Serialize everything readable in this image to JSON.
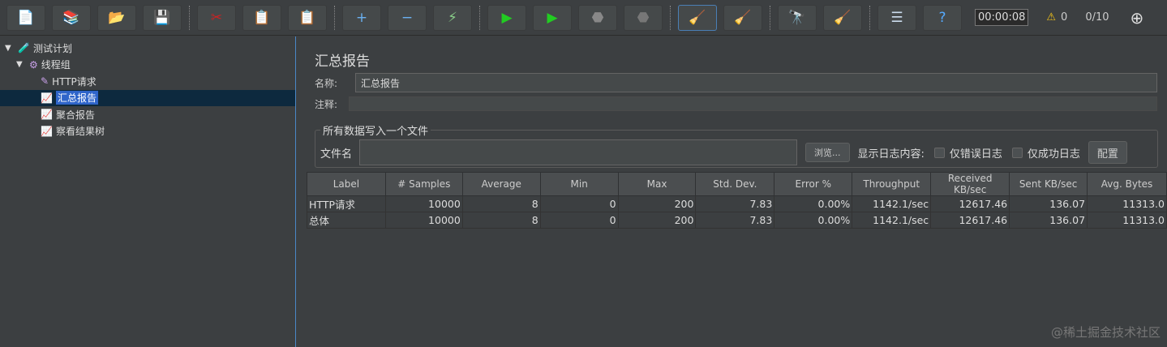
{
  "toolbar": {
    "buttons": [
      [
        "new-icon",
        "📄"
      ],
      [
        "templates-icon",
        "📚"
      ],
      [
        "open-icon",
        "📂"
      ],
      [
        "save-icon",
        "💾"
      ],
      [
        "sep"
      ],
      [
        "cut-icon",
        "✂"
      ],
      [
        "copy-icon",
        "📋"
      ],
      [
        "paste-icon",
        "📋"
      ],
      [
        "sep"
      ],
      [
        "expand-icon",
        "+"
      ],
      [
        "collapse-icon",
        "−"
      ],
      [
        "toggle-icon",
        "⚡"
      ],
      [
        "sep"
      ],
      [
        "start-icon",
        "▶"
      ],
      [
        "start-no-timers-icon",
        "▶"
      ],
      [
        "stop-icon",
        "⬣"
      ],
      [
        "shutdown-icon",
        "⬣"
      ],
      [
        "sep"
      ],
      [
        "clear-icon",
        "🧹"
      ],
      [
        "clear-all-icon",
        "🧹"
      ],
      [
        "sep"
      ],
      [
        "search-icon",
        "🔭"
      ],
      [
        "reset-search-icon",
        "🧹"
      ],
      [
        "sep"
      ],
      [
        "function-helper-icon",
        "☰"
      ],
      [
        "help-icon",
        "?"
      ]
    ],
    "timer": "00:00:08",
    "warnings": "0",
    "threads": "0/10"
  },
  "tree": [
    {
      "label": "测试计划",
      "indent": 0,
      "arrow": "▼",
      "icon": "🧪"
    },
    {
      "label": "线程组",
      "indent": 1,
      "arrow": "▼",
      "icon": "⚙"
    },
    {
      "label": "HTTP请求",
      "indent": 2,
      "icon": "✎"
    },
    {
      "label": "汇总报告",
      "indent": 2,
      "icon": "📈",
      "selected": true
    },
    {
      "label": "聚合报告",
      "indent": 2,
      "icon": "📈"
    },
    {
      "label": "察看结果树",
      "indent": 2,
      "icon": "📈"
    }
  ],
  "main": {
    "title": "汇总报告",
    "name_label": "名称:",
    "name_value": "汇总报告",
    "comment_label": "注释:",
    "file_group": "所有数据写入一个文件",
    "file_label": "文件名",
    "browse": "浏览...",
    "log_label": "显示日志内容:",
    "errors_only": "仅错误日志",
    "success_only": "仅成功日志",
    "configure": "配置"
  },
  "table": {
    "headers": [
      "Label",
      "# Samples",
      "Average",
      "Min",
      "Max",
      "Std. Dev.",
      "Error %",
      "Throughput",
      "Received KB/sec",
      "Sent KB/sec",
      "Avg. Bytes"
    ],
    "rows": [
      [
        "HTTP请求",
        "10000",
        "8",
        "0",
        "200",
        "7.83",
        "0.00%",
        "1142.1/sec",
        "12617.46",
        "136.07",
        "11313.0"
      ],
      [
        "总体",
        "10000",
        "8",
        "0",
        "200",
        "7.83",
        "0.00%",
        "1142.1/sec",
        "12617.46",
        "136.07",
        "11313.0"
      ]
    ]
  },
  "watermark": "@稀土掘金技术社区"
}
